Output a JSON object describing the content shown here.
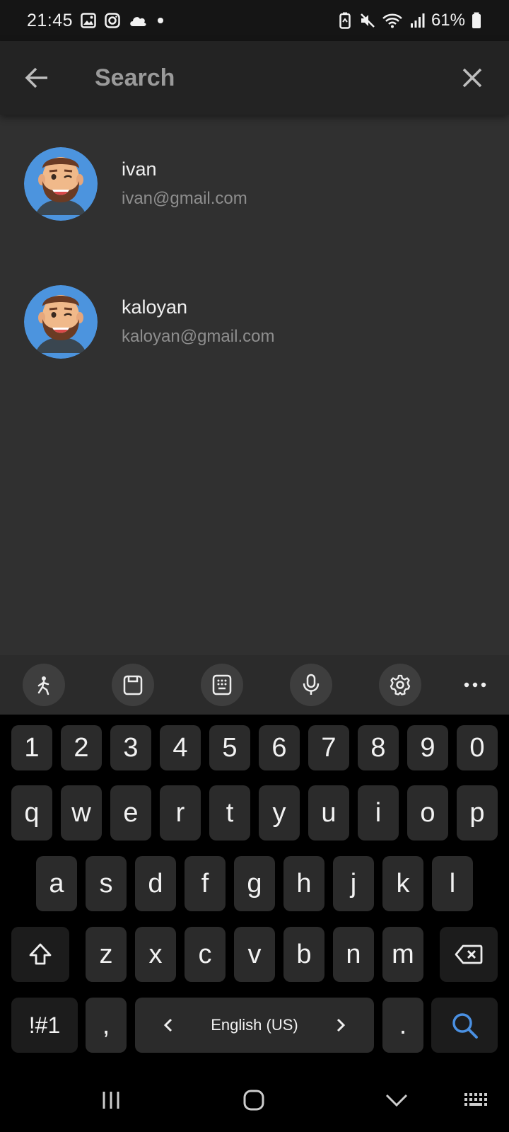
{
  "status_bar": {
    "time": "21:45",
    "left_icons": [
      "gallery-icon",
      "instagram-icon",
      "cloud-icon",
      "dot-icon"
    ],
    "right_icons": [
      "battery-saver-icon",
      "mute-icon",
      "wifi-icon",
      "signal-icon"
    ],
    "battery_percent": "61%"
  },
  "app_bar": {
    "back_icon": "arrow-left-icon",
    "search_placeholder": "Search",
    "search_value": "",
    "clear_icon": "close-icon"
  },
  "results": [
    {
      "name": "ivan",
      "email": "ivan@gmail.com",
      "avatar": "avatar-bearded-man"
    },
    {
      "name": "kaloyan",
      "email": "kaloyan@gmail.com",
      "avatar": "avatar-bearded-man"
    }
  ],
  "keyboard_toolbar": {
    "tools": [
      "sticker-icon",
      "clipboard-icon",
      "keypad-icon",
      "microphone-icon",
      "settings-icon"
    ],
    "more_icon": "more-icon"
  },
  "keyboard": {
    "row_numbers": [
      "1",
      "2",
      "3",
      "4",
      "5",
      "6",
      "7",
      "8",
      "9",
      "0"
    ],
    "row_1": [
      "q",
      "w",
      "e",
      "r",
      "t",
      "y",
      "u",
      "i",
      "o",
      "p"
    ],
    "row_2": [
      "a",
      "s",
      "d",
      "f",
      "g",
      "h",
      "j",
      "k",
      "l"
    ],
    "row_3": [
      "z",
      "x",
      "c",
      "v",
      "b",
      "n",
      "m"
    ],
    "symbols_key": "!#1",
    "comma_key": ",",
    "space_label": "English (US)",
    "period_key": ".",
    "action_key_icon": "search-icon",
    "accent_color": "#4a90e2"
  },
  "nav_bar": {
    "buttons": [
      "recents-icon",
      "home-icon",
      "back-chevron-icon",
      "keyboard-icon"
    ]
  }
}
